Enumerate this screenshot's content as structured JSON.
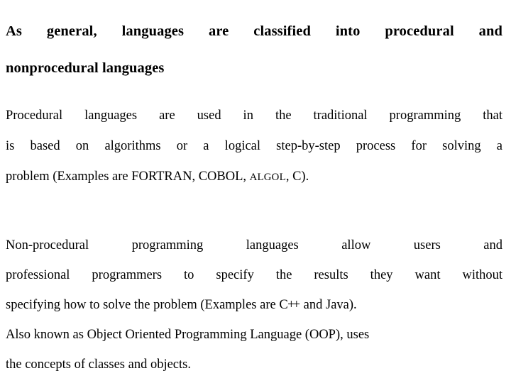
{
  "document": {
    "background_color": "#ffffff",
    "text_color": "#000000",
    "heading": {
      "line1": "As general, languages are classified into procedural and",
      "line2": "nonprocedural languages"
    },
    "paragraphs": [
      {
        "id": "procedural",
        "lines": [
          "Procedural languages are used in the traditional programming that",
          "is based on algorithms or a logical step-by-step process for solving a",
          "problem (Examples are FORTRAN, COBOL, ALGOL, C)."
        ],
        "line3_parts": {
          "before": "problem (Examples are FORTRAN, COBOL, ",
          "smallcaps": "ALGOL",
          "after": ", C)."
        }
      },
      {
        "id": "nonprocedural",
        "lines": [
          "Non-procedural programming languages allow users and",
          "professional programmers to specify the results they want without",
          "specifying how to solve the problem (Examples are C++ and Java).",
          "Also known as Object Oriented Programming Language (OOP), uses",
          "the concepts of classes and objects."
        ],
        "line3_parts": {
          "before": "specifying how to solve the problem (Examples are ",
          "cpp_base": "C",
          "cpp_plus1": "+",
          "cpp_plus2": "+",
          "after": " and Java)."
        }
      }
    ]
  }
}
